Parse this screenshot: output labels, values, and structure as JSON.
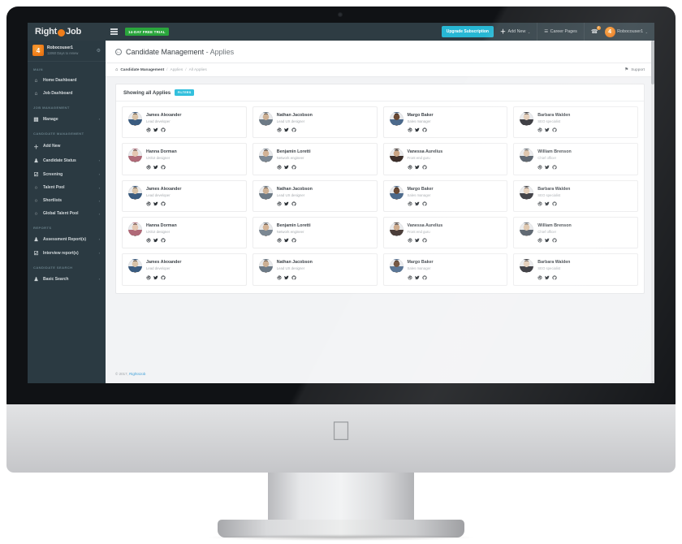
{
  "brand": {
    "text_before": "Right",
    "text_after": "Job",
    "mark": "brand-dot"
  },
  "topnav": {
    "trial_badge": "14-DAY FREE TRIAL",
    "upgrade_label": "Upgrade Subscription",
    "add_new_label": "Add New",
    "career_pages_label": "Career Pages",
    "notification_count": "0",
    "user_name": "Robocouser1",
    "caret": "⌄",
    "plus": "＋",
    "bell_icon": "☎",
    "career_icon": "☰",
    "avatar_initial": "4"
  },
  "sidebar": {
    "profile": {
      "user": "Robocouser1",
      "renew": "11950 Days to renew",
      "gear_icon": "⚙",
      "avatar_initial": "4"
    },
    "sections": [
      {
        "label": "MAIN",
        "items": [
          {
            "label": "Home Dashboard",
            "icon": "⌂",
            "arrow": ""
          },
          {
            "label": "Job Dashboard",
            "icon": "⌂",
            "arrow": ""
          }
        ]
      },
      {
        "label": "JOB MANAGEMENT",
        "items": [
          {
            "label": "Manage",
            "icon": "▤",
            "arrow": "›"
          }
        ]
      },
      {
        "label": "CANDIDATE MANAGEMENT",
        "items": [
          {
            "label": "Add New",
            "icon": "＋",
            "arrow": ""
          },
          {
            "label": "Candidate Status",
            "icon": "♟",
            "arrow": "›"
          },
          {
            "label": "Screening",
            "icon": "☑",
            "arrow": "›"
          },
          {
            "label": "Talent Pool",
            "icon": "○",
            "arrow": "›"
          },
          {
            "label": "Shortlists",
            "icon": "○",
            "arrow": "›"
          },
          {
            "label": "Global Talent Pool",
            "icon": "○",
            "arrow": "›"
          }
        ]
      },
      {
        "label": "REPORTS",
        "items": [
          {
            "label": "Assessment Report(s)",
            "icon": "♟",
            "arrow": "›"
          },
          {
            "label": "Interview report(s)",
            "icon": "☑",
            "arrow": "›"
          }
        ]
      },
      {
        "label": "CANDIDATE SEARCH",
        "items": [
          {
            "label": "Basic Search",
            "icon": "♟",
            "arrow": "›"
          }
        ]
      }
    ]
  },
  "page": {
    "title_strong": "Candidate Management",
    "title_thin": " - Applies",
    "title_icon": "←",
    "breadcrumb": {
      "home_icon": "⌂",
      "root": "Candidate Management",
      "sep1": "/",
      "mid": "Applies",
      "sep2": "/",
      "last": "All Applies"
    },
    "support_label": "Support",
    "support_icon": "⚑"
  },
  "panel": {
    "title": "Showing all Applies",
    "badge": "FILTERS"
  },
  "candidates": [
    {
      "name": "James Alexander",
      "role": "Lead developer"
    },
    {
      "name": "Nathan Jacobson",
      "role": "Lead UX designer"
    },
    {
      "name": "Margo Baker",
      "role": "Sales manager"
    },
    {
      "name": "Barbara Walden",
      "role": "SEO specialist"
    },
    {
      "name": "Hanna Dorman",
      "role": "UX/UI designer"
    },
    {
      "name": "Benjamin Loretti",
      "role": "Network engineer"
    },
    {
      "name": "Vanessa Aurelius",
      "role": "Front end guru"
    },
    {
      "name": "William Brenson",
      "role": "Chief officer"
    },
    {
      "name": "James Alexander",
      "role": "Lead developer"
    },
    {
      "name": "Nathan Jacobson",
      "role": "Lead UX designer"
    },
    {
      "name": "Margo Baker",
      "role": "Sales manager"
    },
    {
      "name": "Barbara Walden",
      "role": "SEO specialist"
    },
    {
      "name": "Hanna Dorman",
      "role": "UX/UI designer"
    },
    {
      "name": "Benjamin Loretti",
      "role": "Network engineer"
    },
    {
      "name": "Vanessa Aurelius",
      "role": "Front end guru"
    },
    {
      "name": "William Brenson",
      "role": "Chief officer"
    },
    {
      "name": "James Alexander",
      "role": "Lead developer"
    },
    {
      "name": "Nathan Jacobson",
      "role": "Lead UX designer"
    },
    {
      "name": "Margo Baker",
      "role": "Sales manager"
    },
    {
      "name": "Barbara Walden",
      "role": "SEO specialist"
    }
  ],
  "footer": {
    "copyright": "© 2017, ",
    "brand_link": "Right4Job"
  },
  "colors": {
    "sidebar": "#2b3a42",
    "topnav": "#2e3c43",
    "accent_cyan": "#27b7d4",
    "badge_cyan": "#33c0dd",
    "trial_green": "#2aa63c",
    "brand_orange": "#f07d1a"
  }
}
